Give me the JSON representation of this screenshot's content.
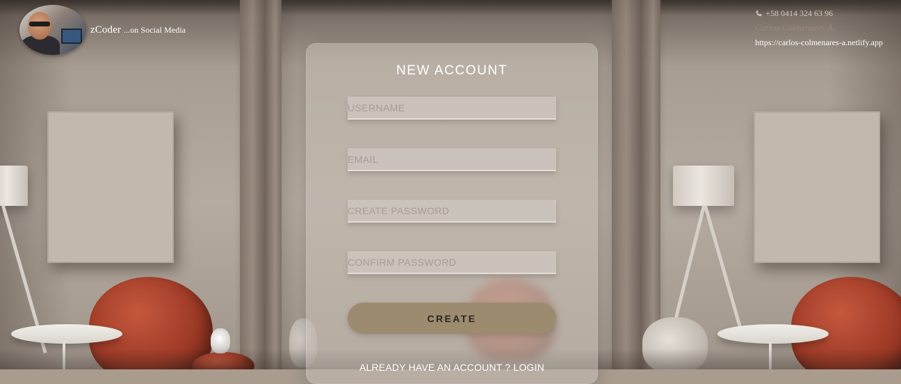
{
  "brand": {
    "name": "zCoder",
    "tagline": "...on Social Media",
    "avatar_icon": "profile-photo"
  },
  "contact": {
    "phone_icon": "phone-icon",
    "phone": "+58 0414 324 63 96",
    "name": "Carlos Colmenares A.",
    "url": "https://carlos-colmenares-a.netlify.app"
  },
  "form": {
    "title": "NEW ACCOUNT",
    "username_placeholder": "USERNAME",
    "email_placeholder": "EMAIL",
    "password_placeholder": "CREATE PASSWORD",
    "confirm_placeholder": "CONFIRM PASSWORD",
    "username_value": "",
    "email_value": "",
    "password_value": "",
    "confirm_value": "",
    "submit_label": "CREATE",
    "login_link": "ALREADY HAVE AN ACCOUNT ? LOGIN"
  },
  "colors": {
    "accent": "#9c8b6e",
    "card_bg": "#c8c0b7",
    "text_light": "#ffffff",
    "contact_name": "#9a8b73"
  }
}
